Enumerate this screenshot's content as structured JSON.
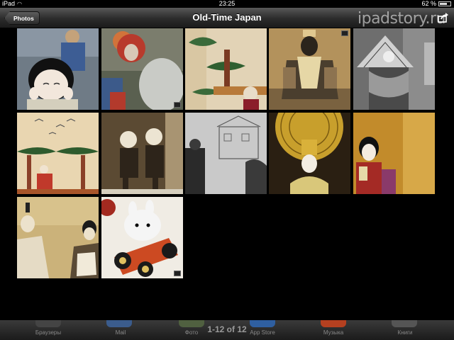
{
  "status": {
    "device": "iPad",
    "time": "23:25",
    "battery": "62 %"
  },
  "nav": {
    "back_label": "Photos",
    "title": "Old-Time Japan",
    "watermark": "ipadstory.ru"
  },
  "bottom": {
    "counter": "1-12 of 12",
    "dock": [
      "Браузеры",
      "Mail",
      "Фото",
      "App Store",
      "Музыка",
      "Книги"
    ]
  },
  "photos": [
    {
      "name": "doll-girl-hands-cheeks",
      "badge": false
    },
    {
      "name": "red-masked-dolls",
      "badge": true
    },
    {
      "name": "pine-tree-figure",
      "badge": false
    },
    {
      "name": "sepia-warrior-doll",
      "badge": true
    },
    {
      "name": "bw-fan-dancer",
      "badge": false
    },
    {
      "name": "birds-pine-scene",
      "badge": false
    },
    {
      "name": "sepia-mouse-figures",
      "badge": false
    },
    {
      "name": "bw-house-figurine",
      "badge": false
    },
    {
      "name": "golden-crown-doll",
      "badge": false
    },
    {
      "name": "kimono-girl-doll",
      "badge": false
    },
    {
      "name": "sepia-court-dolls",
      "badge": false
    },
    {
      "name": "white-rabbit-cart",
      "badge": true
    }
  ]
}
